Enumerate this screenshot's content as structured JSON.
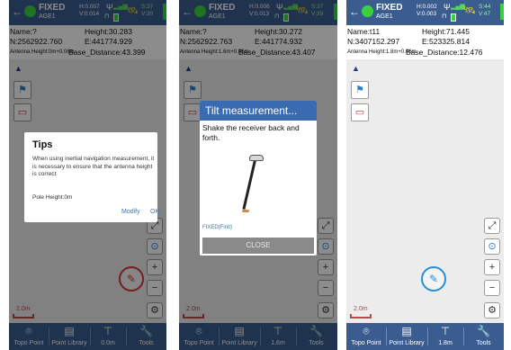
{
  "screens": [
    {
      "status": {
        "back_icon": "back-arrow-icon",
        "fix": "FIXED",
        "age": "AGE1",
        "h": "H:0.007",
        "v": "V:0.014",
        "sats": "S:37",
        "sats_view": "V:39",
        "fix_color": "#39d23e",
        "bar_color": "#3a5c8f"
      },
      "info": {
        "name": "Name:?",
        "height": "Height:30.283",
        "north": "N:2562922.760",
        "east": "E:441774.929",
        "antenna": "Antenna Height:0m+0.06m",
        "base_distance": "Base_Distance:43.399"
      },
      "scale": "2.0m",
      "bottom_nav": {
        "items": [
          {
            "label": "Topo Point",
            "icon": "map-pin-icon"
          },
          {
            "label": "Point Library",
            "icon": "document-list-icon"
          },
          {
            "label": "0.0m",
            "icon": "survey-pole-icon"
          },
          {
            "label": "Tools",
            "icon": "wrench-icon"
          }
        ]
      },
      "dialog": {
        "title": "Tips",
        "message": "When using inertial navigation measurement, it is necessary to ensure that the antenna height is correct",
        "pole": "Pole Height:0m",
        "modify": "Modify",
        "ok": "OK"
      }
    },
    {
      "status": {
        "back_icon": "back-arrow-icon",
        "fix": "FIXED",
        "age": "AGE1",
        "h": "H:0.006",
        "v": "V:0.013",
        "sats": "S:37",
        "sats_view": "V:39",
        "fix_color": "#39d23e",
        "bar_color": "#3a5c8f"
      },
      "info": {
        "name": "Name:?",
        "height": "Height:30.272",
        "north": "N:2562922.763",
        "east": "E:441774.932",
        "antenna": "Antenna Height:1.6m+0.06m",
        "base_distance": "Base_Distance:43.407"
      },
      "scale": "2.0m",
      "bottom_nav": {
        "items": [
          {
            "label": "Topo Point",
            "icon": "map-pin-icon"
          },
          {
            "label": "Point Library",
            "icon": "document-list-icon"
          },
          {
            "label": "1.6m",
            "icon": "survey-pole-icon"
          },
          {
            "label": "Tools",
            "icon": "wrench-icon"
          }
        ]
      },
      "dialog": {
        "title": "Tilt measurement...",
        "message": "Shake the receiver back and forth.",
        "status": "FIXED(Finit)",
        "close": "CLOSE",
        "header_color": "#3a6ab0"
      }
    },
    {
      "status": {
        "back_icon": "back-arrow-icon",
        "fix": "FIXED",
        "age": "AGE1",
        "h": "H:0.002",
        "v": "V:0.003",
        "sats": "S:44",
        "sats_view": "V:47",
        "fix_color": "#39d23e",
        "bar_color": "#3a5c8f"
      },
      "info": {
        "name": "Name:t11",
        "height": "Height:71.445",
        "north": "N:3407152.297",
        "east": "E:523325.814",
        "antenna": "Antenna Height:1.8m+0.06m",
        "base_distance": "Base_Distance:12.476"
      },
      "scale": "2.0m",
      "bottom_nav": {
        "items": [
          {
            "label": "Topo Point",
            "icon": "map-pin-icon"
          },
          {
            "label": "Point Library",
            "icon": "document-list-icon"
          },
          {
            "label": "1.8m",
            "icon": "survey-pole-icon"
          },
          {
            "label": "Tools",
            "icon": "wrench-icon"
          }
        ]
      }
    }
  ]
}
